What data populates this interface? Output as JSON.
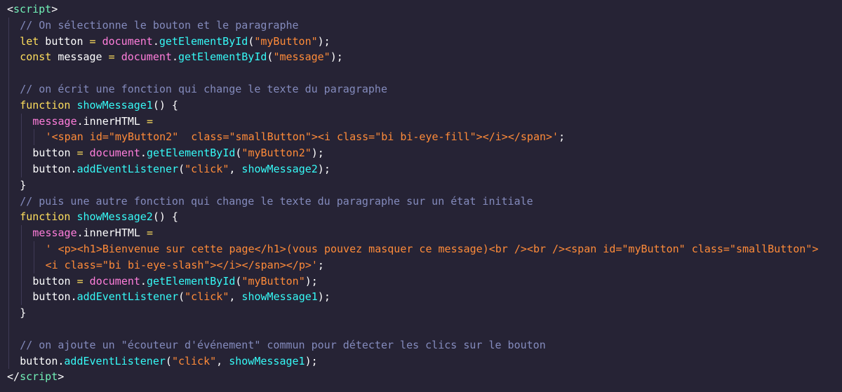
{
  "editor": {
    "colors": {
      "background": "#262335",
      "comment": "#848bbd",
      "keyword": "#fede5d",
      "string": "#ff8b39",
      "function": "#36f9f6",
      "tag": "#72f1b8",
      "variable": "#ff7edb",
      "plain": "#ffffff"
    },
    "lines": [
      {
        "indent": 0,
        "tokens": [
          {
            "t": "<",
            "c": "tagbracket"
          },
          {
            "t": "script",
            "c": "tag"
          },
          {
            "t": ">",
            "c": "tagbracket"
          }
        ]
      },
      {
        "indent": 1,
        "tokens": [
          {
            "t": "// On sélectionne le bouton et le paragraphe",
            "c": "comment"
          }
        ]
      },
      {
        "indent": 1,
        "tokens": [
          {
            "t": "let",
            "c": "keyword"
          },
          {
            "t": " button ",
            "c": "plain"
          },
          {
            "t": "=",
            "c": "operator"
          },
          {
            "t": " ",
            "c": "plain"
          },
          {
            "t": "document",
            "c": "var"
          },
          {
            "t": ".",
            "c": "punct"
          },
          {
            "t": "getElementById",
            "c": "func"
          },
          {
            "t": "(",
            "c": "punct"
          },
          {
            "t": "\"myButton\"",
            "c": "string"
          },
          {
            "t": ");",
            "c": "punct"
          }
        ]
      },
      {
        "indent": 1,
        "tokens": [
          {
            "t": "const",
            "c": "keyword"
          },
          {
            "t": " message ",
            "c": "plain"
          },
          {
            "t": "=",
            "c": "operator"
          },
          {
            "t": " ",
            "c": "plain"
          },
          {
            "t": "document",
            "c": "var"
          },
          {
            "t": ".",
            "c": "punct"
          },
          {
            "t": "getElementById",
            "c": "func"
          },
          {
            "t": "(",
            "c": "punct"
          },
          {
            "t": "\"message\"",
            "c": "string"
          },
          {
            "t": ");",
            "c": "punct"
          }
        ]
      },
      {
        "indent": 1,
        "tokens": []
      },
      {
        "indent": 1,
        "tokens": [
          {
            "t": "// on écrit une fonction qui change le texte du paragraphe",
            "c": "comment"
          }
        ]
      },
      {
        "indent": 1,
        "tokens": [
          {
            "t": "function",
            "c": "keyword"
          },
          {
            "t": " ",
            "c": "plain"
          },
          {
            "t": "showMessage1",
            "c": "func"
          },
          {
            "t": "() {",
            "c": "punct"
          }
        ]
      },
      {
        "indent": 2,
        "tokens": [
          {
            "t": "message",
            "c": "var"
          },
          {
            "t": ".innerHTML ",
            "c": "plain"
          },
          {
            "t": "=",
            "c": "operator"
          }
        ]
      },
      {
        "indent": 3,
        "tokens": [
          {
            "t": "'<span id=\"myButton2\"  class=\"smallButton\"><i class=\"bi bi-eye-fill\"></i></span>'",
            "c": "string"
          },
          {
            "t": ";",
            "c": "punct"
          }
        ]
      },
      {
        "indent": 2,
        "tokens": [
          {
            "t": "button ",
            "c": "plain"
          },
          {
            "t": "=",
            "c": "operator"
          },
          {
            "t": " ",
            "c": "plain"
          },
          {
            "t": "document",
            "c": "var"
          },
          {
            "t": ".",
            "c": "punct"
          },
          {
            "t": "getElementById",
            "c": "func"
          },
          {
            "t": "(",
            "c": "punct"
          },
          {
            "t": "\"myButton2\"",
            "c": "string"
          },
          {
            "t": ");",
            "c": "punct"
          }
        ]
      },
      {
        "indent": 2,
        "tokens": [
          {
            "t": "button",
            "c": "plain"
          },
          {
            "t": ".",
            "c": "punct"
          },
          {
            "t": "addEventListener",
            "c": "func"
          },
          {
            "t": "(",
            "c": "punct"
          },
          {
            "t": "\"click\"",
            "c": "string"
          },
          {
            "t": ", ",
            "c": "punct"
          },
          {
            "t": "showMessage2",
            "c": "func"
          },
          {
            "t": ");",
            "c": "punct"
          }
        ]
      },
      {
        "indent": 1,
        "tokens": [
          {
            "t": "}",
            "c": "punct"
          }
        ]
      },
      {
        "indent": 1,
        "tokens": [
          {
            "t": "// puis une autre fonction qui change le texte du paragraphe sur un état initiale",
            "c": "comment"
          }
        ]
      },
      {
        "indent": 1,
        "tokens": [
          {
            "t": "function",
            "c": "keyword"
          },
          {
            "t": " ",
            "c": "plain"
          },
          {
            "t": "showMessage2",
            "c": "func"
          },
          {
            "t": "() {",
            "c": "punct"
          }
        ]
      },
      {
        "indent": 2,
        "tokens": [
          {
            "t": "message",
            "c": "var"
          },
          {
            "t": ".innerHTML ",
            "c": "plain"
          },
          {
            "t": "=",
            "c": "operator"
          }
        ]
      },
      {
        "indent": 3,
        "tokens": [
          {
            "t": "' <p><h1>Bienvenue sur cette page</h1>(vous pouvez masquer ce message)<br /><br /><span id=\"myButton\" class=\"smallButton\">",
            "c": "string"
          }
        ]
      },
      {
        "indent": 3,
        "tokens": [
          {
            "t": "<i class=\"bi bi-eye-slash\"></i></span></p>'",
            "c": "string"
          },
          {
            "t": ";",
            "c": "punct"
          }
        ]
      },
      {
        "indent": 2,
        "tokens": [
          {
            "t": "button ",
            "c": "plain"
          },
          {
            "t": "=",
            "c": "operator"
          },
          {
            "t": " ",
            "c": "plain"
          },
          {
            "t": "document",
            "c": "var"
          },
          {
            "t": ".",
            "c": "punct"
          },
          {
            "t": "getElementById",
            "c": "func"
          },
          {
            "t": "(",
            "c": "punct"
          },
          {
            "t": "\"myButton\"",
            "c": "string"
          },
          {
            "t": ");",
            "c": "punct"
          }
        ]
      },
      {
        "indent": 2,
        "tokens": [
          {
            "t": "button",
            "c": "plain"
          },
          {
            "t": ".",
            "c": "punct"
          },
          {
            "t": "addEventListener",
            "c": "func"
          },
          {
            "t": "(",
            "c": "punct"
          },
          {
            "t": "\"click\"",
            "c": "string"
          },
          {
            "t": ", ",
            "c": "punct"
          },
          {
            "t": "showMessage1",
            "c": "func"
          },
          {
            "t": ");",
            "c": "punct"
          }
        ]
      },
      {
        "indent": 1,
        "tokens": [
          {
            "t": "}",
            "c": "punct"
          }
        ]
      },
      {
        "indent": 1,
        "tokens": []
      },
      {
        "indent": 1,
        "tokens": [
          {
            "t": "// on ajoute un \"écouteur d'événement\" commun pour détecter les clics sur le bouton",
            "c": "comment"
          }
        ]
      },
      {
        "indent": 1,
        "tokens": [
          {
            "t": "button",
            "c": "plain"
          },
          {
            "t": ".",
            "c": "punct"
          },
          {
            "t": "addEventListener",
            "c": "func"
          },
          {
            "t": "(",
            "c": "punct"
          },
          {
            "t": "\"click\"",
            "c": "string"
          },
          {
            "t": ", ",
            "c": "punct"
          },
          {
            "t": "showMessage1",
            "c": "func"
          },
          {
            "t": ");",
            "c": "punct"
          }
        ]
      },
      {
        "indent": 0,
        "tokens": [
          {
            "t": "</",
            "c": "tagbracket"
          },
          {
            "t": "script",
            "c": "tag"
          },
          {
            "t": ">",
            "c": "tagbracket"
          }
        ]
      }
    ]
  }
}
